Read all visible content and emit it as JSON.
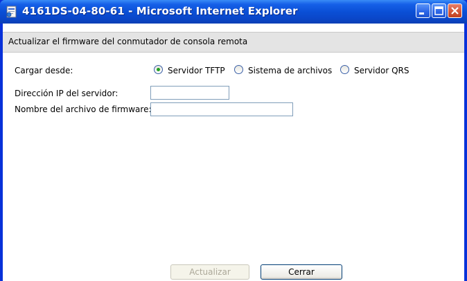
{
  "window": {
    "title": "4161DS-04-80-61 - Microsoft Internet Explorer",
    "colors": {
      "titlebar": "#0a4fd6",
      "frame": "#0831d9",
      "header_bar": "#e4e4e4",
      "radio_selected": "#21a121"
    },
    "controls": {
      "minimize_icon": "minimize-icon",
      "maximize_icon": "maximize-icon",
      "close_icon": "close-icon"
    }
  },
  "header": {
    "title": "Actualizar el firmware del conmutador de consola remota"
  },
  "form": {
    "load_from_label": "Cargar desde:",
    "sources": [
      {
        "label": "Servidor TFTP",
        "selected": true
      },
      {
        "label": "Sistema de archivos",
        "selected": false
      },
      {
        "label": "Servidor QRS",
        "selected": false
      }
    ],
    "server_ip_label": "Dirección IP del servidor:",
    "server_ip_value": "",
    "firmware_file_label": "Nombre del archivo de firmware:",
    "firmware_file_value": ""
  },
  "buttons": {
    "update_label": "Actualizar",
    "update_enabled": false,
    "close_label": "Cerrar"
  }
}
